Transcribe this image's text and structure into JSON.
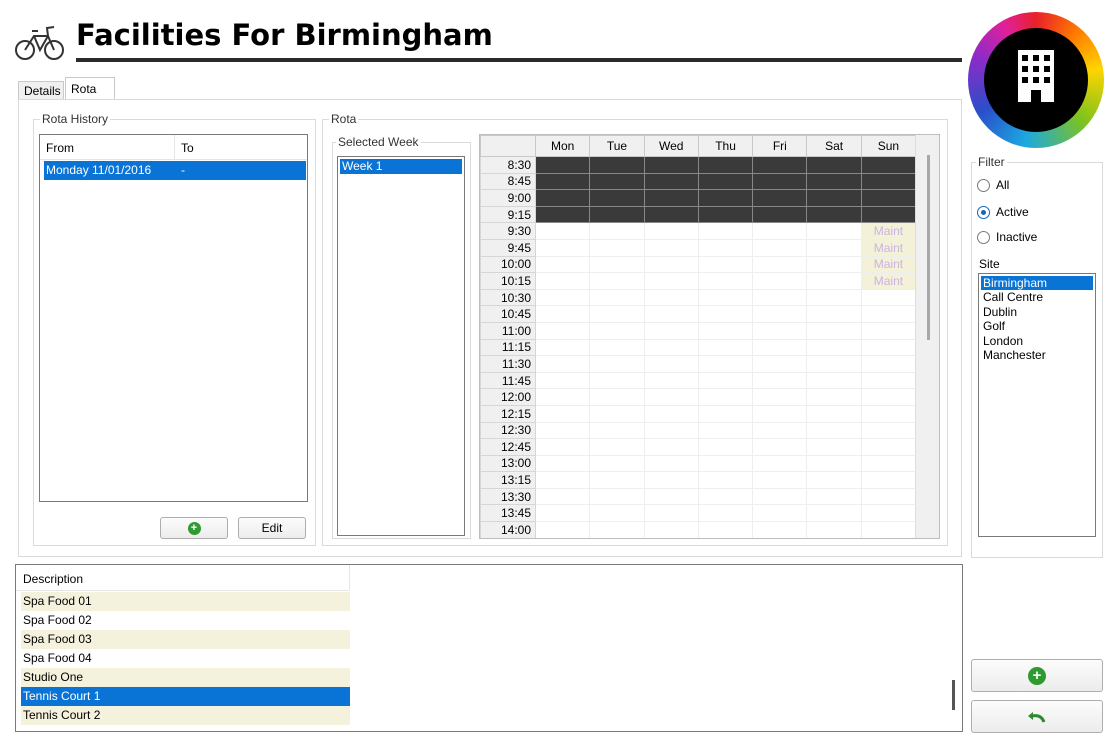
{
  "title": "Facilities For Birmingham",
  "tabs": [
    {
      "label": "Details"
    },
    {
      "label": "Rota"
    }
  ],
  "rota_history": {
    "group_label": "Rota History",
    "columns": [
      "From",
      "To"
    ],
    "rows": [
      {
        "from": "Monday 11/01/2016",
        "to": "-",
        "selected": true
      }
    ],
    "edit_label": "Edit"
  },
  "rota": {
    "group_label": "Rota",
    "selected_week_label": "Selected Week",
    "weeks": [
      "Week 1"
    ],
    "days": [
      "Mon",
      "Tue",
      "Wed",
      "Thu",
      "Fri",
      "Sat",
      "Sun"
    ],
    "times": [
      "8:30",
      "8:45",
      "9:00",
      "9:15",
      "9:30",
      "9:45",
      "10:00",
      "10:15",
      "10:30",
      "10:45",
      "11:00",
      "11:15",
      "11:30",
      "11:45",
      "12:00",
      "12:15",
      "12:30",
      "12:45",
      "13:00",
      "13:15",
      "13:30",
      "13:45",
      "14:00"
    ],
    "booked_slots": [
      "8:30",
      "8:45",
      "9:00",
      "9:15"
    ],
    "maint_label": "Maint",
    "maint_day": "Sun",
    "maint_slots": [
      "9:30",
      "9:45",
      "10:00",
      "10:15"
    ]
  },
  "facilities": {
    "column": "Description",
    "items": [
      "Spa Food 01",
      "Spa Food 02",
      "Spa Food 03",
      "Spa Food 04",
      "Studio One",
      "Tennis Court 1",
      "Tennis Court 2"
    ],
    "selected": "Tennis Court 1"
  },
  "filter": {
    "label": "Filter",
    "options": [
      "All",
      "Active",
      "Inactive"
    ],
    "selected": "Active",
    "site_label": "Site",
    "sites": [
      "Birmingham",
      "Call Centre",
      "Dublin",
      "Golf",
      "London",
      "Manchester"
    ],
    "selected_site": "Birmingham"
  },
  "colors": {
    "selection": "#0a74d6",
    "booked": "#3a3a3a",
    "maint_bg": "#f3f1d8",
    "add_green": "#2f9a2f"
  },
  "icons": {
    "bicycle": "bicycle-icon",
    "building": "building-icon",
    "add": "add-icon",
    "undo": "undo-icon"
  }
}
